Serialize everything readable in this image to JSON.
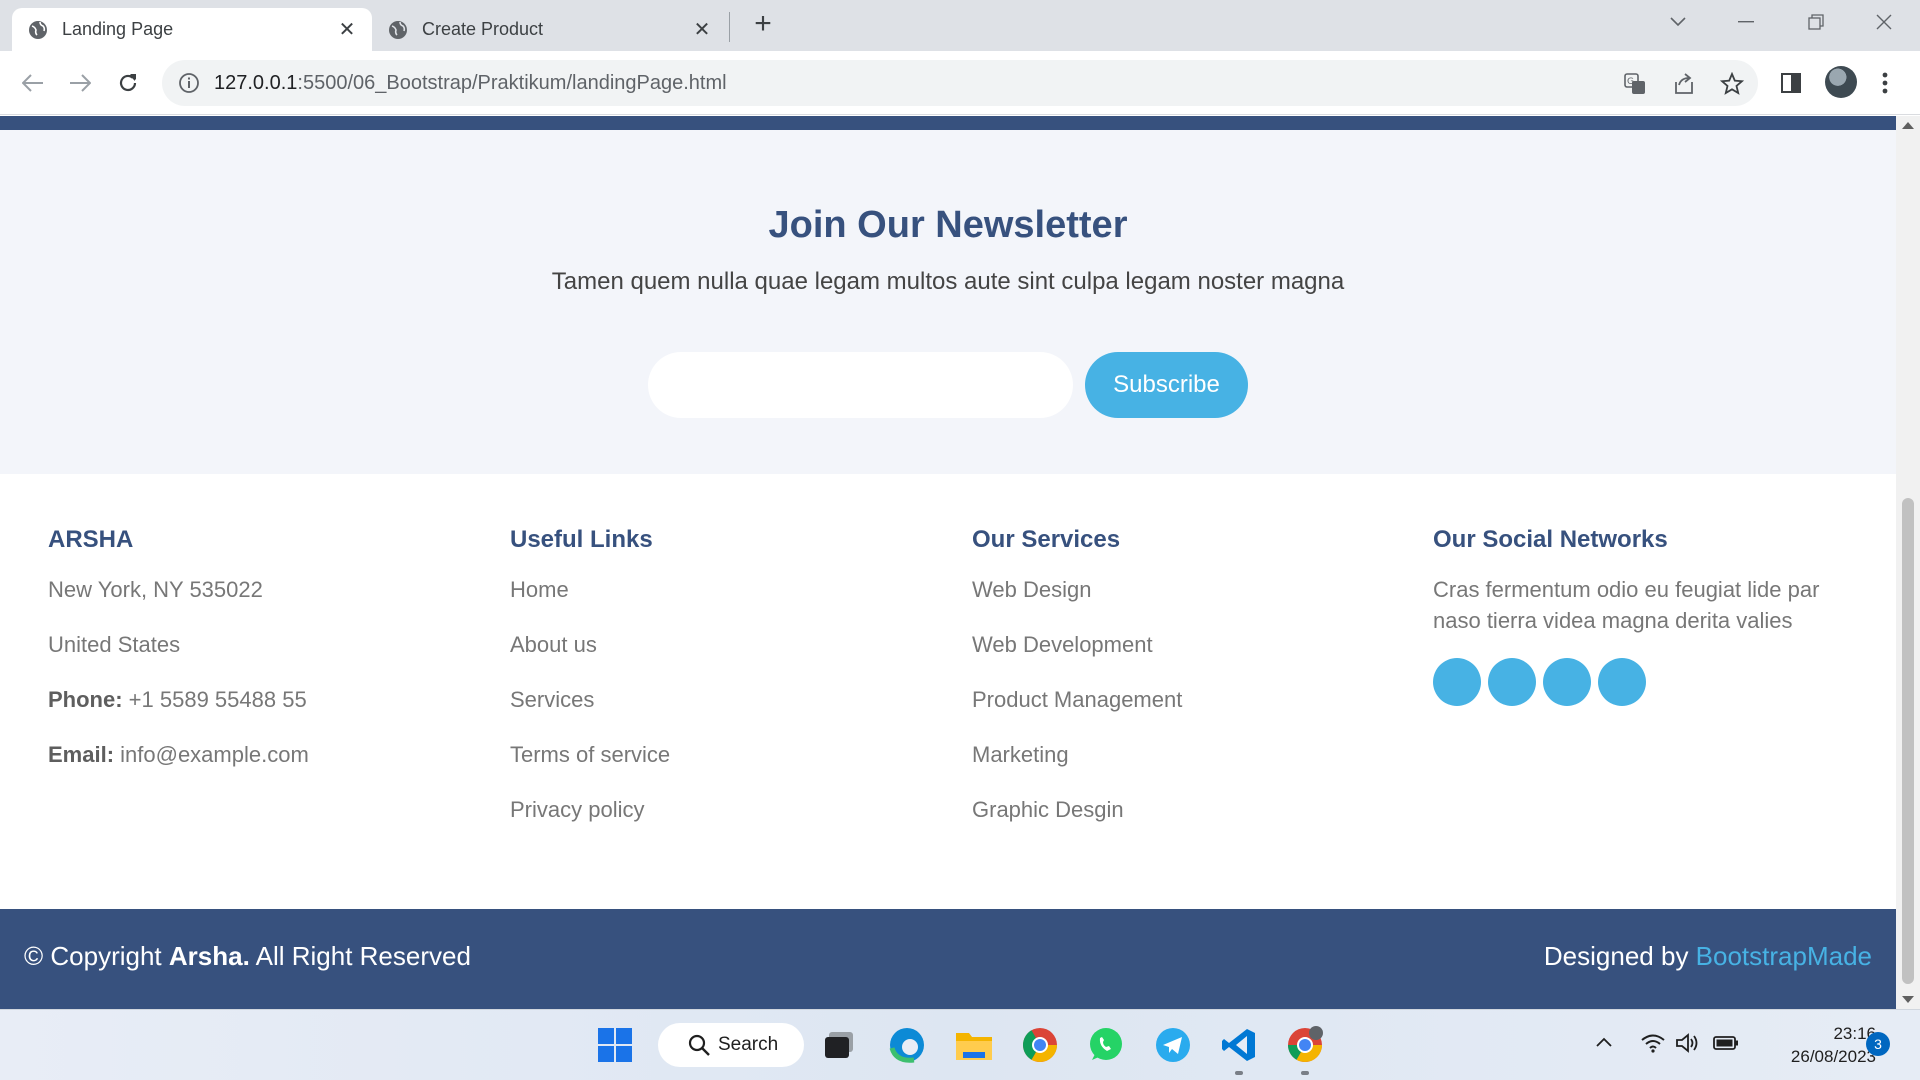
{
  "browser": {
    "tabs": [
      {
        "title": "Landing Page",
        "active": true
      },
      {
        "title": "Create Product",
        "active": false
      }
    ],
    "url_host": "127.0.0.1",
    "url_rest": ":5500/06_Bootstrap/Praktikum/landingPage.html"
  },
  "newsletter": {
    "title": "Join Our Newsletter",
    "subtitle": "Tamen quem nulla quae legam multos aute sint culpa legam noster magna",
    "email_value": "",
    "button_label": "Subscribe"
  },
  "footer": {
    "brand": {
      "title": "ARSHA",
      "address_line1": "New York, NY 535022",
      "address_line2": "United States",
      "phone_label": "Phone:",
      "phone_value": " +1 5589 55488 55",
      "email_label": "Email:",
      "email_value": " info@example.com"
    },
    "useful_links": {
      "title": "Useful Links",
      "items": [
        "Home",
        "About us",
        "Services",
        "Terms of service",
        "Privacy policy"
      ]
    },
    "services": {
      "title": "Our Services",
      "items": [
        "Web Design",
        "Web Development",
        "Product Management",
        "Marketing",
        "Graphic Desgin"
      ]
    },
    "social": {
      "title": "Our Social Networks",
      "text_line1": "Cras fermentum odio eu feugiat lide par",
      "text_line2": "naso tierra videa magna derita valies"
    },
    "copyright_prefix": "© Copyright ",
    "copyright_brand": "Arsha.",
    "copyright_suffix": " All Right Reserved",
    "designed_by": "Designed by ",
    "designer": "BootstrapMade"
  },
  "taskbar": {
    "search_label": "Search",
    "time": "23:16",
    "date": "26/08/2023",
    "notification_count": "3"
  },
  "colors": {
    "primary": "#37517e",
    "accent": "#47b2e4",
    "section_bg": "#f3f5fa"
  }
}
